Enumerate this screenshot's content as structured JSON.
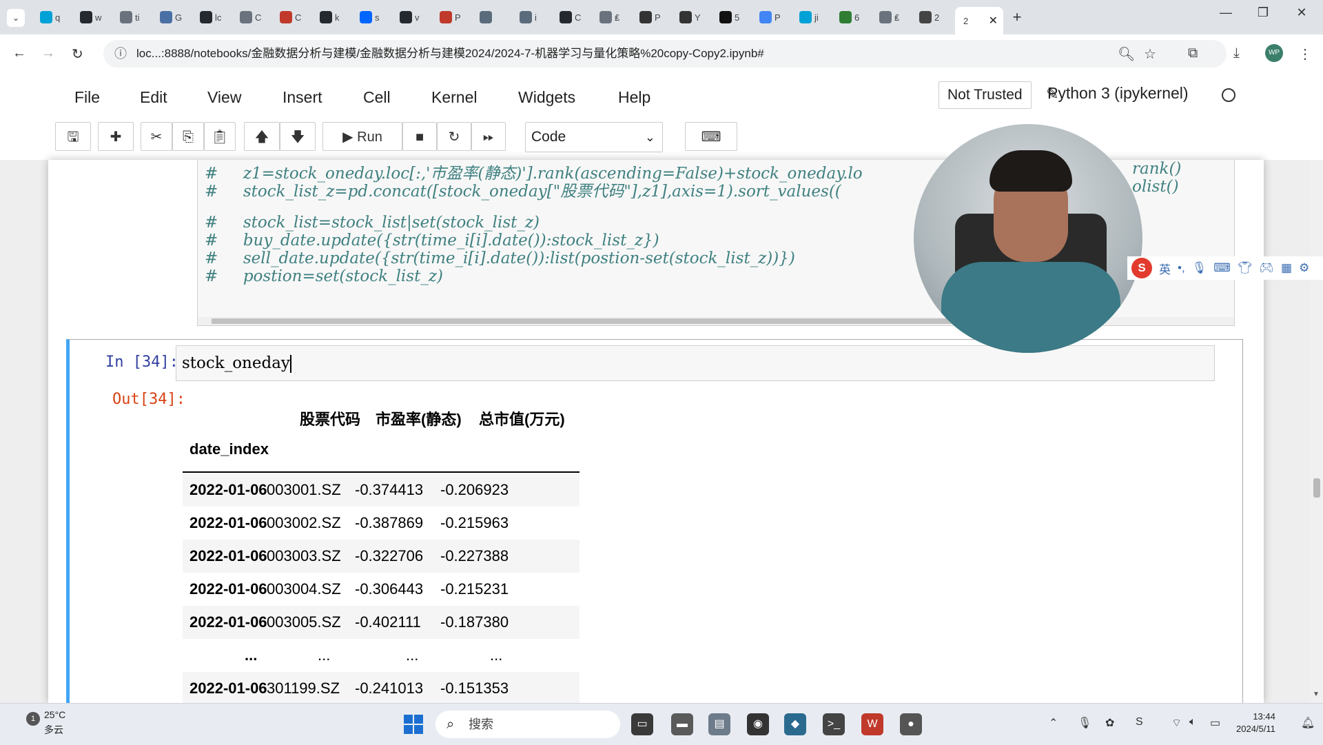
{
  "browser": {
    "tabs": [
      {
        "icon": "bilibili-icon",
        "label": "q",
        "color": "#00a1d6"
      },
      {
        "icon": "github-icon",
        "label": "w",
        "color": "#24292f"
      },
      {
        "icon": "fork-icon",
        "label": "ti",
        "color": "#6a737d"
      },
      {
        "icon": "remote-icon",
        "label": "G",
        "color": "#4a6fa5"
      },
      {
        "icon": "github-icon",
        "label": "lc",
        "color": "#24292f"
      },
      {
        "icon": "cube-icon",
        "label": "C",
        "color": "#6a737d"
      },
      {
        "icon": "mail-icon",
        "label": "C",
        "color": "#c0392b"
      },
      {
        "icon": "github-icon",
        "label": "k",
        "color": "#24292f"
      },
      {
        "icon": "zhihu-icon",
        "label": "s",
        "color": "#0066ff"
      },
      {
        "icon": "github-icon",
        "label": "v",
        "color": "#24292f"
      },
      {
        "icon": "csdn-icon",
        "label": "P",
        "color": "#c0392b"
      },
      {
        "icon": "cloud-icon",
        "label": "",
        "color": "#5a6b7b"
      },
      {
        "icon": "cloud-icon",
        "label": "i",
        "color": "#5a6b7b"
      },
      {
        "icon": "github-icon",
        "label": "C",
        "color": "#24292f"
      },
      {
        "icon": "loading-icon",
        "label": "₤",
        "color": "#6a737d"
      },
      {
        "icon": "cap-icon",
        "label": "P",
        "color": "#333333"
      },
      {
        "icon": "youtube-icon",
        "label": "Y",
        "color": "#333333"
      },
      {
        "icon": "openai-icon",
        "label": "5",
        "color": "#111111"
      },
      {
        "icon": "google-icon",
        "label": "P",
        "color": "#4285f4"
      },
      {
        "icon": "bilibili-icon",
        "label": "ji",
        "color": "#00a1d6"
      },
      {
        "icon": "chart-icon",
        "label": "6",
        "color": "#2e7d32"
      },
      {
        "icon": "loading-icon",
        "label": "₤",
        "color": "#6a737d"
      },
      {
        "icon": "book-icon",
        "label": "2",
        "color": "#444444"
      }
    ],
    "active_tab": {
      "label": "2",
      "close": "✕"
    },
    "new_tab": "+",
    "url": "loc⁠.⁠.⁠.⁠:8⁠8⁠8⁠8/⁠n⁠o⁠t⁠ebooks/金融数据分析与建模/金融数据分析与建模2024/2024-7-机器学习与量化策略%20copy-Copy2.ipynb#",
    "profile": "WP"
  },
  "jupyter": {
    "menu": [
      "File",
      "Edit",
      "View",
      "Insert",
      "Cell",
      "Kernel",
      "Widgets",
      "Help"
    ],
    "trust_status": "Not Trusted",
    "kernel_name": "Python 3 (ipykernel)",
    "toolbar": {
      "run_label": "Run",
      "cell_type": "Code"
    }
  },
  "previous_cell": {
    "lines": [
      "#     z1=stock_oneday.loc[:,'市盈率(静态)'].rank(ascending=False)+stock_oneday.lo",
      "#     stock_list_z=pd.concat([stock_oneday[\"股票代码\"],z1],axis=1).sort_values((",
      "",
      "#     stock_list=stock_list|set(stock_list_z)",
      "#     buy_date.update({str(time_i[i].date()):stock_list_z})",
      "#     sell_date.update({str(time_i[i].date()):list(postion-set(stock_list_z))})",
      "#     postion=set(stock_list_z)"
    ],
    "overflow_right": [
      "rank()",
      "olist()"
    ]
  },
  "active_cell": {
    "in_prompt": "In  [34]:",
    "out_prompt": "Out[34]:",
    "code": "stock_oneday"
  },
  "dataframe": {
    "columns": [
      "股票代码",
      "市盈率(静态)",
      "总市值(万元)"
    ],
    "index_name": "date_index",
    "rows": [
      [
        "2022-01-06",
        "003001.SZ",
        "-0.374413",
        "-0.206923"
      ],
      [
        "2022-01-06",
        "003002.SZ",
        "-0.387869",
        "-0.215963"
      ],
      [
        "2022-01-06",
        "003003.SZ",
        "-0.322706",
        "-0.227388"
      ],
      [
        "2022-01-06",
        "003004.SZ",
        "-0.306443",
        "-0.215231"
      ],
      [
        "2022-01-06",
        "003005.SZ",
        "-0.402111",
        "-0.187380"
      ],
      [
        "...",
        "...",
        "...",
        "..."
      ],
      [
        "2022-01-06",
        "301199.SZ",
        "-0.241013",
        "-0.151353"
      ]
    ]
  },
  "ime": {
    "lang": "英"
  },
  "taskbar": {
    "weather_temp": "25°C",
    "weather_cond": "多云",
    "weather_badge": "1",
    "search_placeholder": "搜索",
    "time": "13:44",
    "date": "2024/5/11"
  }
}
